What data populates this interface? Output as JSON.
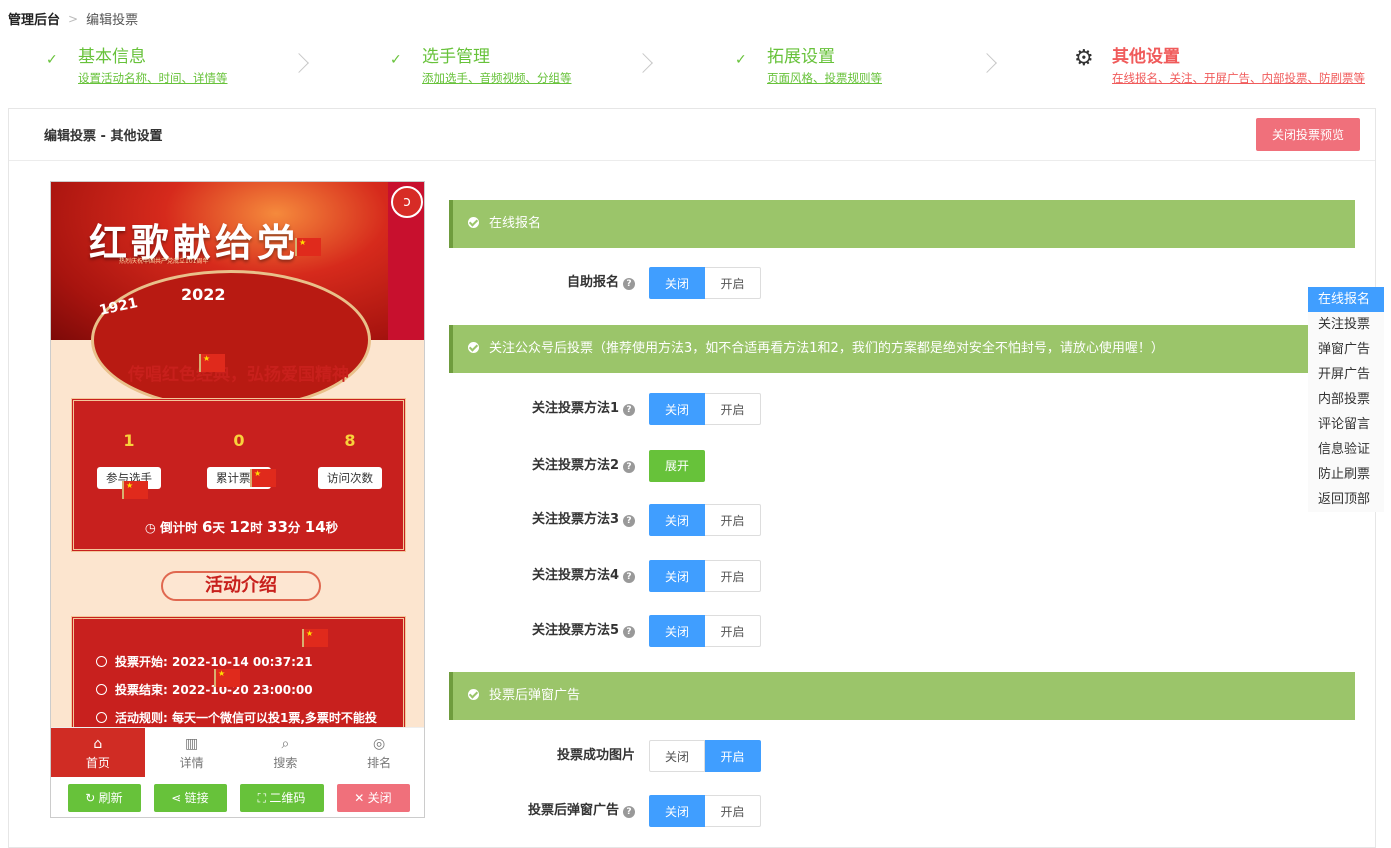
{
  "breadcrumb": {
    "root": "管理后台",
    "separator": ">",
    "current": "编辑投票"
  },
  "steps": [
    {
      "title": "基本信息",
      "subtitle": "设置活动名称、时间、详情等",
      "state": "done"
    },
    {
      "title": "选手管理",
      "subtitle": "添加选手、音频视频、分组等",
      "state": "done"
    },
    {
      "title": "拓展设置",
      "subtitle": "页面风格、投票规则等",
      "state": "done"
    },
    {
      "title": "其他设置",
      "subtitle": "在线报名、关注、开屏广告、内部投票、防刷票等",
      "state": "active"
    }
  ],
  "panel": {
    "title": "编辑投票 - 其他设置",
    "close_preview": "关闭投票预览"
  },
  "preview": {
    "banner_title": "红歌献给党",
    "banner_sub": "热烈庆祝中国共产党成立101周年",
    "year_left": "1921",
    "year_right": "2022",
    "music_icon": "ↄ",
    "slogan": "传唱红色经典，弘扬爱国精神",
    "stats": [
      {
        "value": "1",
        "label": "参与选手"
      },
      {
        "value": "0",
        "label": "累计票数"
      },
      {
        "value": "8",
        "label": "访问次数"
      }
    ],
    "countdown": {
      "prefix": "倒计时",
      "days": "6",
      "d_unit": "天",
      "hours": "12",
      "h_unit": "时",
      "mins": "33",
      "m_unit": "分",
      "secs": "14",
      "s_unit": "秒"
    },
    "intro_title": "活动介绍",
    "info": [
      "投票开始: 2022-10-14 00:37:21",
      "投票结束: 2022-10-20 23:00:00",
      "活动规则: 每天一个微信可以投1票,多票时不能投"
    ],
    "tabs": [
      {
        "icon": "⌂",
        "label": "首页"
      },
      {
        "icon": "▥",
        "label": "详情"
      },
      {
        "icon": "⌕",
        "label": "搜索"
      },
      {
        "icon": "◎",
        "label": "排名"
      }
    ],
    "buttons": {
      "refresh": "↻ 刷新",
      "link": "⋖ 链接",
      "qrcode": "⛶ 二维码",
      "close": "✕ 关闭"
    }
  },
  "sections": {
    "online_signup": "在线报名",
    "follow": "关注公众号后投票（推荐使用方法3，如不合适再看方法1和2，我们的方案都是绝对安全不怕封号，请放心使用喔！）",
    "popup_ad": "投票后弹窗广告"
  },
  "settings": {
    "self_signup": {
      "label": "自助报名",
      "state": "off"
    },
    "method1": {
      "label": "关注投票方法1",
      "state": "off"
    },
    "method2": {
      "label": "关注投票方法2",
      "action": "展开"
    },
    "method3": {
      "label": "关注投票方法3",
      "state": "off"
    },
    "method4": {
      "label": "关注投票方法4",
      "state": "off"
    },
    "method5": {
      "label": "关注投票方法5",
      "state": "off"
    },
    "success_image": {
      "label": "投票成功图片",
      "state": "on"
    },
    "popup_after": {
      "label": "投票后弹窗广告",
      "state": "off"
    },
    "off_label": "关闭",
    "on_label": "开启",
    "help": "?"
  },
  "side_nav": [
    "在线报名",
    "关注投票",
    "弹窗广告",
    "开屏广告",
    "内部投票",
    "评论留言",
    "信息验证",
    "防止刷票",
    "返回顶部"
  ],
  "colors": {
    "green": "#67c23a",
    "section": "#9bc56a",
    "blue": "#409eff",
    "red": "#f05b5b"
  }
}
